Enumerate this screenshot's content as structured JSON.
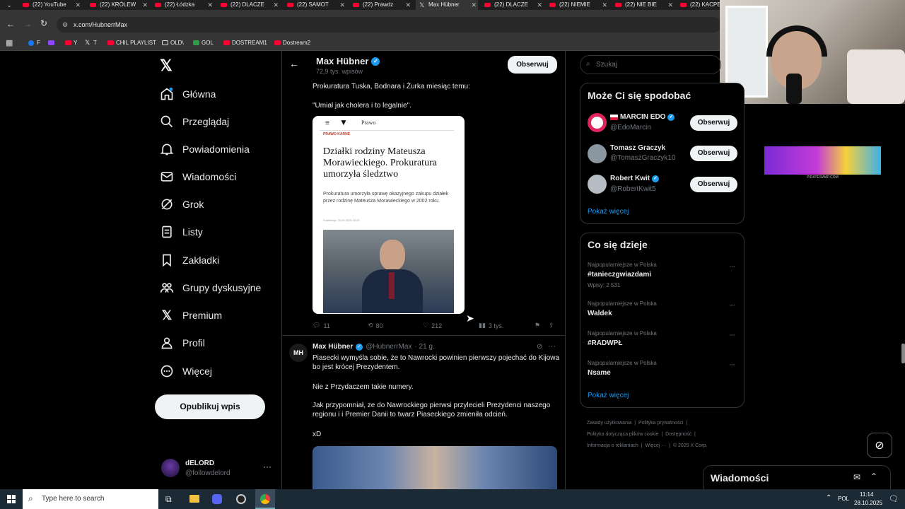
{
  "browser": {
    "tabs": [
      {
        "label": "(22) YouTube",
        "icon": "youtube-icon"
      },
      {
        "label": "(22) KRÓLEW",
        "icon": "youtube-icon"
      },
      {
        "label": "(22) Łódzka",
        "icon": "youtube-icon"
      },
      {
        "label": "(22) DLACZE",
        "icon": "youtube-icon"
      },
      {
        "label": "(22) SAMOT",
        "icon": "youtube-icon"
      },
      {
        "label": "(22) Prawdz",
        "icon": "youtube-icon"
      },
      {
        "label": "Max Hübner",
        "icon": "x-icon"
      },
      {
        "label": "(22) DLACZE",
        "icon": "youtube-icon"
      },
      {
        "label": "(22) NIEMIE",
        "icon": "youtube-icon"
      },
      {
        "label": "(22) NIE BIE",
        "icon": "youtube-icon"
      },
      {
        "label": "(22) KACPE",
        "icon": "youtube-icon"
      }
    ],
    "url": "x.com/HubnerrMax",
    "bookmarks": [
      {
        "label": "F"
      },
      {
        "label": ""
      },
      {
        "label": "Y"
      },
      {
        "label": "T"
      },
      {
        "label": "CHIL PLAYLIST"
      },
      {
        "label": "OLD\\"
      },
      {
        "label": "GOL"
      },
      {
        "label": "DOSTREAM1"
      },
      {
        "label": "Dostream2"
      }
    ]
  },
  "nav": {
    "items": [
      {
        "label": "Główna",
        "icon": "home-icon"
      },
      {
        "label": "Przeglądaj",
        "icon": "search-icon"
      },
      {
        "label": "Powiadomienia",
        "icon": "bell-icon"
      },
      {
        "label": "Wiadomości",
        "icon": "mail-icon"
      },
      {
        "label": "Grok",
        "icon": "grok-icon"
      },
      {
        "label": "Listy",
        "icon": "list-icon"
      },
      {
        "label": "Zakładki",
        "icon": "bookmark-icon"
      },
      {
        "label": "Grupy dyskusyjne",
        "icon": "people-icon"
      },
      {
        "label": "Premium",
        "icon": "x-icon"
      },
      {
        "label": "Profil",
        "icon": "person-icon"
      },
      {
        "label": "Więcej",
        "icon": "more-circle-icon"
      }
    ],
    "post_label": "Opublikuj wpis",
    "account": {
      "name": "dELORD",
      "handle": "@followdelord"
    }
  },
  "profile_header": {
    "name": "Max Hübner",
    "posts": "72,9 tys. wpisów",
    "follow_label": "Obserwuj"
  },
  "tweet1": {
    "line1": "Prokuratura Tuska, Bodnara i Żurka miesiąc temu:",
    "line2": "\"Umiał jak cholera i to legalnie\".",
    "article": {
      "section": "Prawo",
      "tag": "PRAWO KARNE",
      "headline": "Działki rodziny Mateusza Morawieckiego. Prokuratura umorzyła śledztwo",
      "lead": "Prokuratura umorzyła sprawę okazyjnego zakupu działek przez rodzinę Mateusza Morawieckiego w 2002 roku.",
      "date": "Publikacja: 25.09.2025 16:25"
    },
    "replies": "11",
    "reposts": "80",
    "likes": "212",
    "views": "3 tys."
  },
  "tweet2": {
    "name": "Max Hübner",
    "handle": "@HubnerrMax",
    "time": "· 21 g.",
    "p1": "Piasecki wymyśla sobie, że to Nawrocki powinien pierwszy pojechać do Kijowa bo jest krócej Prezydentem.",
    "p2": "Nie z Przydaczem takie numery.",
    "p3": "Jak przypomniał, ze do Nawrockiego pierwsi przylecieli Prezydenci naszego regionu i i Premier Danii to twarz Piaseckiego zmieniła odcień.",
    "p4": "xD"
  },
  "search": {
    "placeholder": "Szukaj"
  },
  "suggestions": {
    "title": "Może Ci się spodobać",
    "users": [
      {
        "name": "MARCIN EDO",
        "handle": "@EdoMarcin"
      },
      {
        "name": "Tomasz Graczyk",
        "handle": "@TomaszGraczyk10"
      },
      {
        "name": "Robert Kwit",
        "handle": "@RobertKwit5"
      }
    ],
    "follow_label": "Obserwuj",
    "more": "Pokaż więcej"
  },
  "trends": {
    "title": "Co się dzieje",
    "items": [
      {
        "context": "Najpopularniejsze w Polska",
        "name": "#tanieczgwiazdami",
        "count": "Wpisy: 2 531"
      },
      {
        "context": "Najpopularniejsze w Polska",
        "name": "Waldek",
        "count": ""
      },
      {
        "context": "Najpopularniejsze w Polska",
        "name": "#RADWPŁ",
        "count": ""
      },
      {
        "context": "Najpopularniejsze w Polska",
        "name": "Nsame",
        "count": ""
      }
    ],
    "more": "Pokaż więcej"
  },
  "footer": {
    "links": [
      "Zasady użytkowania",
      "Polityka prywatności",
      "Polityka dotycząca plików cookie",
      "Dostępność",
      "Informacja o reklamach",
      "Więcej ···",
      "© 2025 X Corp."
    ]
  },
  "messages_drawer": {
    "title": "Wiadomości"
  },
  "banner": {
    "caption": "PIRATESWAP.COM"
  },
  "taskbar": {
    "search_placeholder": "Type here to search",
    "lang": "POL",
    "time": "11:14",
    "date": "28.10.2025"
  },
  "colors": {
    "accent": "#1d9bf0",
    "background": "#000000",
    "border": "#2f3336",
    "muted": "#71767b"
  }
}
